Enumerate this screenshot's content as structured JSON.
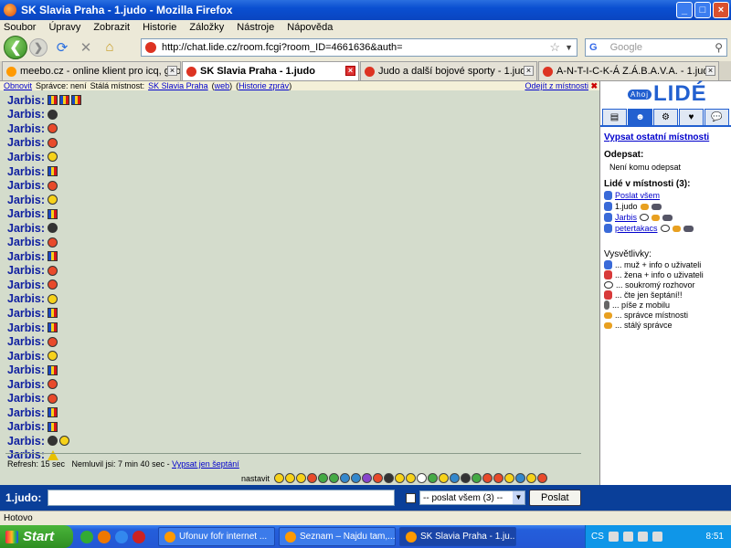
{
  "window": {
    "title": "SK Slavia Praha - 1.judo - Mozilla Firefox"
  },
  "menu": [
    "Soubor",
    "Úpravy",
    "Zobrazit",
    "Historie",
    "Záložky",
    "Nástroje",
    "Nápověda"
  ],
  "nav": {
    "url": "http://chat.lide.cz/room.fcgi?room_ID=4661636&auth=",
    "search_placeholder": "Google"
  },
  "tabs": [
    {
      "label": "meebo.cz - online klient pro icq, google ...",
      "active": false
    },
    {
      "label": "SK Slavia Praha - 1.judo",
      "active": true
    },
    {
      "label": "Judo a další bojové sporty - 1.judo",
      "active": false
    },
    {
      "label": "A-N-T-I-C-K-Á Z.Á.B.A.V.A. - 1.judo",
      "active": false
    }
  ],
  "infobar": {
    "refresh": "Obnovit",
    "admin_label": "Správce: není",
    "room_label": "Stálá místnost:",
    "room_link": "SK Slavia Praha",
    "web_link": "web",
    "history_link": "Historie zpráv",
    "leave": "Odejít z místnosti"
  },
  "messages": [
    {
      "user": "Jarbis",
      "emoticons": [
        "flagro",
        "flagro",
        "flagro"
      ]
    },
    {
      "user": "Jarbis",
      "emoticons": [
        "dark"
      ]
    },
    {
      "user": "Jarbis",
      "emoticons": [
        "red"
      ]
    },
    {
      "user": "Jarbis",
      "emoticons": [
        "red"
      ]
    },
    {
      "user": "Jarbis",
      "emoticons": [
        "yellow"
      ]
    },
    {
      "user": "Jarbis",
      "emoticons": [
        "flagro"
      ]
    },
    {
      "user": "Jarbis",
      "emoticons": [
        "red"
      ]
    },
    {
      "user": "Jarbis",
      "emoticons": [
        "yellow"
      ]
    },
    {
      "user": "Jarbis",
      "emoticons": [
        "flagro"
      ]
    },
    {
      "user": "Jarbis",
      "emoticons": [
        "dark"
      ]
    },
    {
      "user": "Jarbis",
      "emoticons": [
        "red"
      ]
    },
    {
      "user": "Jarbis",
      "emoticons": [
        "flagro"
      ]
    },
    {
      "user": "Jarbis",
      "emoticons": [
        "red"
      ]
    },
    {
      "user": "Jarbis",
      "emoticons": [
        "red"
      ]
    },
    {
      "user": "Jarbis",
      "emoticons": [
        "yellow"
      ]
    },
    {
      "user": "Jarbis",
      "emoticons": [
        "flagro"
      ]
    },
    {
      "user": "Jarbis",
      "emoticons": [
        "flagro"
      ]
    },
    {
      "user": "Jarbis",
      "emoticons": [
        "red"
      ]
    },
    {
      "user": "Jarbis",
      "emoticons": [
        "yellow"
      ]
    },
    {
      "user": "Jarbis",
      "emoticons": [
        "flagro"
      ]
    },
    {
      "user": "Jarbis",
      "emoticons": [
        "red"
      ]
    },
    {
      "user": "Jarbis",
      "emoticons": [
        "red"
      ]
    },
    {
      "user": "Jarbis",
      "emoticons": [
        "flagro"
      ]
    },
    {
      "user": "Jarbis",
      "emoticons": [
        "flagro"
      ]
    },
    {
      "user": "Jarbis",
      "emoticons": [
        "dark",
        "yellow"
      ]
    },
    {
      "user": "Jarbis",
      "emoticons": [
        "warn"
      ]
    }
  ],
  "footer": {
    "refresh": "Refresh: 15 sec",
    "idle": "Nemluvil jsi: 7 min 40 sec -",
    "whisper_link": "Vypsat jen šeptání",
    "settings": "nastavit"
  },
  "sidebar": {
    "logo_small": "Ahoj",
    "logo": "LIDÉ",
    "list_rooms_link": "Vypsat ostatní místnosti",
    "away_title": "Odepsat:",
    "away_text": "Není komu odepsat",
    "people_title": "Lidé v místnosti (3):",
    "send_all": "Poslat všem",
    "people": [
      {
        "name": "1.judo",
        "link": false,
        "icon": "man"
      },
      {
        "name": "Jarbis",
        "link": true,
        "icon": "man"
      },
      {
        "name": "petertakacs",
        "link": true,
        "icon": "man"
      }
    ],
    "legend_title": "Vysvětlivky:",
    "legend": [
      {
        "icon": "man",
        "text": "... muž + info o uživateli"
      },
      {
        "icon": "woman",
        "text": "... žena + info o uživateli"
      },
      {
        "icon": "bubble",
        "text": "... soukromý rozhovor"
      },
      {
        "icon": "woman",
        "text": "... čte jen šeptání!!"
      },
      {
        "icon": "mob",
        "text": "... píše z mobilu"
      },
      {
        "icon": "crown",
        "text": "... správce místnosti"
      },
      {
        "icon": "crown",
        "text": "... stálý správce"
      }
    ]
  },
  "input": {
    "nick": "1.judo:",
    "target": "-- poslat všem (3) --",
    "send": "Poslat"
  },
  "status": "Hotovo",
  "taskbar": {
    "start": "Start",
    "tasks": [
      {
        "label": "Ufonuv fofr internet ...",
        "active": false
      },
      {
        "label": "Seznam – Najdu tam,...",
        "active": false
      },
      {
        "label": "SK Slavia Praha - 1.ju...",
        "active": true
      }
    ],
    "lang": "CS",
    "clock": "8:51"
  },
  "colors": {
    "accent": "#0a3f99",
    "chat_bg": "#d4dccc",
    "nick_color": "#1020a0"
  }
}
